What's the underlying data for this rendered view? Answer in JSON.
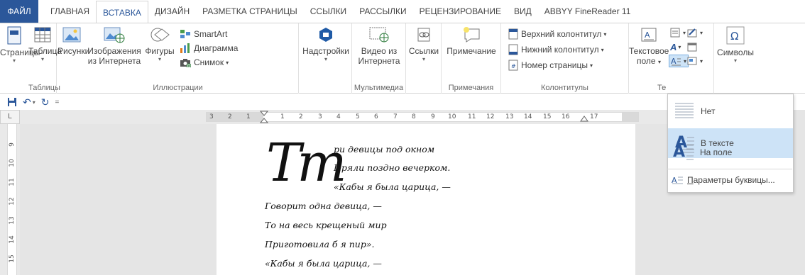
{
  "tabs": [
    "ФАЙЛ",
    "ГЛАВНАЯ",
    "ВСТАВКА",
    "ДИЗАЙН",
    "РАЗМЕТКА СТРАНИЦЫ",
    "ССЫЛКИ",
    "РАССЫЛКИ",
    "РЕЦЕНЗИРОВАНИЕ",
    "ВИД",
    "ABBYY FineReader 11"
  ],
  "active_tab": "ВСТАВКА",
  "ribbon": {
    "pages": "Страницы",
    "table": "Таблица",
    "tables_group": "Таблицы",
    "pictures": "Рисунки",
    "online_pictures_1": "Изображения",
    "online_pictures_2": "из Интернета",
    "shapes": "Фигуры",
    "smartart": "SmartArt",
    "chart": "Диаграмма",
    "screenshot": "Снимок",
    "illustrations_group": "Иллюстрации",
    "addins": "Надстройки",
    "online_video_1": "Видео из",
    "online_video_2": "Интернета",
    "media_group": "Мультимедиа",
    "links": "Ссылки",
    "comment": "Примечание",
    "comments_group": "Примечания",
    "header": "Верхний колонтитул",
    "footer": "Нижний колонтитул",
    "page_number": "Номер страницы",
    "hf_group": "Колонтитулы",
    "textbox_1": "Текстовое",
    "textbox_2": "поле",
    "text_group_partial": "Те",
    "symbols": "Символы"
  },
  "ruler": {
    "top_numbers": [
      "3",
      "2",
      "1",
      "1",
      "2",
      "3",
      "4",
      "5",
      "6",
      "7",
      "8",
      "9",
      "10",
      "11",
      "12",
      "13",
      "14",
      "15",
      "16",
      "17"
    ],
    "left_numbers": [
      "9",
      "10",
      "11",
      "12",
      "13",
      "14",
      "15"
    ],
    "corner": "L"
  },
  "document": {
    "dropcap": "Тт",
    "lines": [
      "ри девицы под окном",
      "Пряли поздно вечерком.",
      "«Кабы я была царица, —",
      "Говорит одна девица, —",
      "То на весь крещеный мир",
      "Приготовила б я пир».",
      "«Кабы я была царица, —"
    ]
  },
  "dropcap_menu": {
    "items": [
      "Нет",
      "В тексте",
      "На поле"
    ],
    "selected": "В тексте",
    "options": "Параметры буквицы..."
  },
  "colors": {
    "accent": "#2b579a",
    "selection": "#cde3f7"
  }
}
